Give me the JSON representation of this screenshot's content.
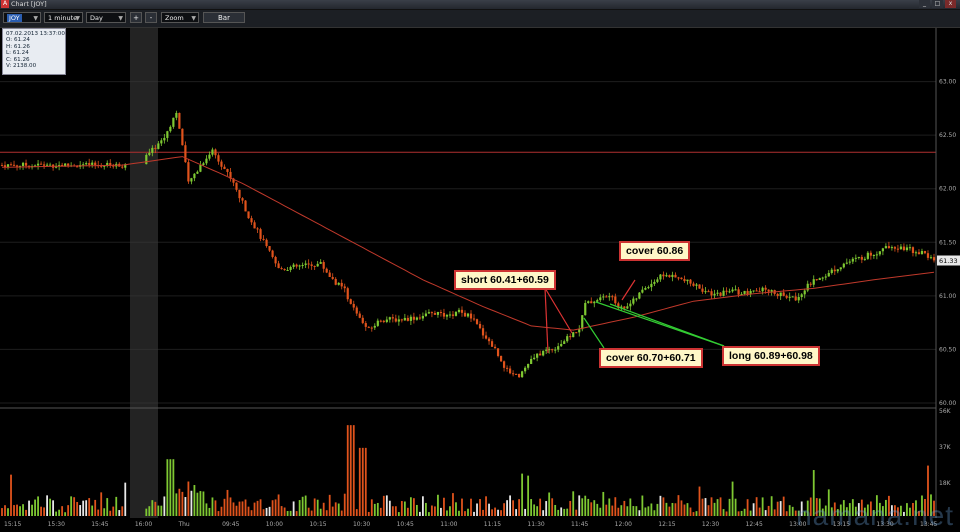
{
  "window": {
    "app_icon": "chart-app-icon",
    "title": "Chart [JOY]",
    "controls": [
      "_",
      "□",
      "x"
    ]
  },
  "toolbar": {
    "symbol": "JOY",
    "interval": "1 minute",
    "span": "Day",
    "zoom_in": "+",
    "zoom_out": "-",
    "zoom": "Zoom",
    "style": "Bar"
  },
  "ohlc_box": {
    "date": "07.02.2013 13:37:00",
    "open": "O: 61.24",
    "high": "H: 61.26",
    "low": "L: 61.24",
    "close": "C: 61.26",
    "volume": "V: 2138.00"
  },
  "colors": {
    "up": "#7ec832",
    "down": "#e0531c",
    "ma": "#c0392b",
    "hline": "#b03030",
    "session_shade": "#3a3a3a",
    "annotation_border": "#cc3333",
    "annotation_fill": "#fff7c8"
  },
  "annotations": [
    {
      "text": "short 60.41+60.59"
    },
    {
      "text": "cover 60.86"
    },
    {
      "text": "cover 60.70+60.71"
    },
    {
      "text": "long 60.89+60.98"
    }
  ],
  "chart_data": {
    "type": "candlestick",
    "price_axis": {
      "ticks": [
        "63.00",
        "62.50",
        "62.00",
        "61.50",
        "61.00",
        "60.50",
        "60.00"
      ],
      "range": [
        60.0,
        63.5
      ]
    },
    "volume_axis": {
      "ticks": [
        "56K",
        "37K",
        "18K"
      ],
      "range": [
        0,
        56000
      ]
    },
    "last_price": "61.33",
    "time_axis": [
      "15:15",
      "15:30",
      "15:45",
      "16:00",
      "Thu",
      "09:45",
      "10:00",
      "10:15",
      "10:30",
      "10:45",
      "11:00",
      "11:15",
      "11:30",
      "11:45",
      "12:00",
      "12:15",
      "12:30",
      "12:45",
      "13:00",
      "13:15",
      "13:30",
      "13:45"
    ],
    "horizontal_line": 62.34,
    "price_path": [
      {
        "t": 0,
        "p": 62.22
      },
      {
        "t": 20,
        "p": 62.22
      },
      {
        "t": 24,
        "p": 62.3
      },
      {
        "t": 27,
        "p": 62.48
      },
      {
        "t": 29,
        "p": 62.72
      },
      {
        "t": 30,
        "p": 62.4
      },
      {
        "t": 31,
        "p": 62.05
      },
      {
        "t": 33,
        "p": 62.22
      },
      {
        "t": 35,
        "p": 62.36
      },
      {
        "t": 38,
        "p": 62.1
      },
      {
        "t": 41,
        "p": 61.75
      },
      {
        "t": 44,
        "p": 61.45
      },
      {
        "t": 46,
        "p": 61.25
      },
      {
        "t": 50,
        "p": 61.28
      },
      {
        "t": 53,
        "p": 61.3
      },
      {
        "t": 55,
        "p": 61.15
      },
      {
        "t": 57,
        "p": 61.05
      },
      {
        "t": 59,
        "p": 60.82
      },
      {
        "t": 61,
        "p": 60.68
      },
      {
        "t": 63,
        "p": 60.78
      },
      {
        "t": 66,
        "p": 60.78
      },
      {
        "t": 69,
        "p": 60.8
      },
      {
        "t": 72,
        "p": 60.84
      },
      {
        "t": 74,
        "p": 60.8
      },
      {
        "t": 76,
        "p": 60.85
      },
      {
        "t": 78,
        "p": 60.8
      },
      {
        "t": 80,
        "p": 60.65
      },
      {
        "t": 82,
        "p": 60.5
      },
      {
        "t": 84,
        "p": 60.3
      },
      {
        "t": 86,
        "p": 60.26
      },
      {
        "t": 88,
        "p": 60.4
      },
      {
        "t": 90,
        "p": 60.48
      },
      {
        "t": 92,
        "p": 60.52
      },
      {
        "t": 94,
        "p": 60.6
      },
      {
        "t": 96,
        "p": 60.7
      },
      {
        "t": 97,
        "p": 60.92
      },
      {
        "t": 99,
        "p": 60.97
      },
      {
        "t": 101,
        "p": 61.0
      },
      {
        "t": 103,
        "p": 60.88
      },
      {
        "t": 105,
        "p": 60.95
      },
      {
        "t": 107,
        "p": 61.08
      },
      {
        "t": 110,
        "p": 61.2
      },
      {
        "t": 113,
        "p": 61.15
      },
      {
        "t": 116,
        "p": 61.08
      },
      {
        "t": 118,
        "p": 61.0
      },
      {
        "t": 121,
        "p": 61.05
      },
      {
        "t": 124,
        "p": 61.02
      },
      {
        "t": 127,
        "p": 61.06
      },
      {
        "t": 130,
        "p": 61.0
      },
      {
        "t": 132,
        "p": 60.97
      },
      {
        "t": 134,
        "p": 61.1
      },
      {
        "t": 137,
        "p": 61.2
      },
      {
        "t": 140,
        "p": 61.3
      },
      {
        "t": 143,
        "p": 61.36
      },
      {
        "t": 146,
        "p": 61.42
      },
      {
        "t": 148,
        "p": 61.47
      },
      {
        "t": 150,
        "p": 61.45
      },
      {
        "t": 153,
        "p": 61.4
      },
      {
        "t": 155,
        "p": 61.33
      }
    ],
    "ma_path": [
      {
        "t": 0,
        "p": 62.2
      },
      {
        "t": 20,
        "p": 62.22
      },
      {
        "t": 30,
        "p": 62.3
      },
      {
        "t": 40,
        "p": 62.05
      },
      {
        "t": 50,
        "p": 61.75
      },
      {
        "t": 60,
        "p": 61.45
      },
      {
        "t": 70,
        "p": 61.15
      },
      {
        "t": 80,
        "p": 60.9
      },
      {
        "t": 88,
        "p": 60.72
      },
      {
        "t": 95,
        "p": 60.68
      },
      {
        "t": 105,
        "p": 60.8
      },
      {
        "t": 115,
        "p": 60.95
      },
      {
        "t": 125,
        "p": 61.02
      },
      {
        "t": 135,
        "p": 61.07
      },
      {
        "t": 145,
        "p": 61.15
      },
      {
        "t": 155,
        "p": 61.22
      }
    ]
  }
}
